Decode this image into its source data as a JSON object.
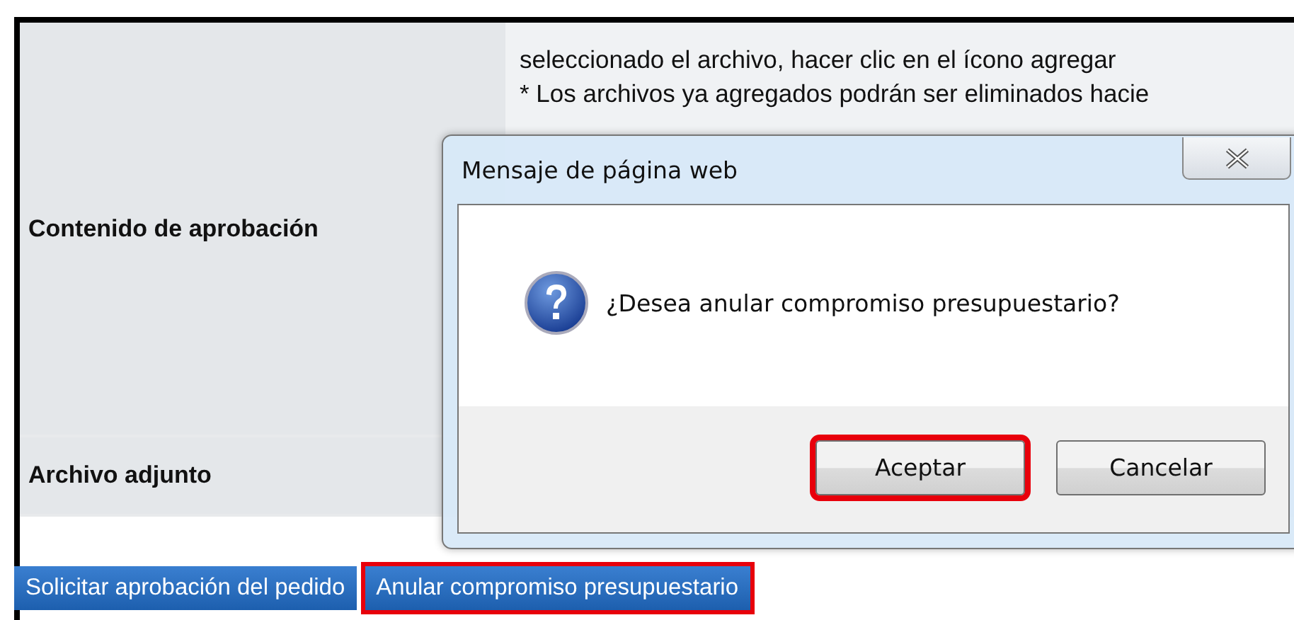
{
  "form": {
    "rows": [
      {
        "label": "Contenido de aprobación",
        "lines": [
          "seleccionado el archivo, hacer clic en el ícono agregar",
          "* Los archivos ya agregados podrán ser eliminados hacie"
        ]
      },
      {
        "label": "Archivo adjunto",
        "lines": []
      }
    ]
  },
  "actions": [
    {
      "label": "Solicitar aprobación del pedido",
      "highlighted": false
    },
    {
      "label": "Anular compromiso presupuestario",
      "highlighted": true
    }
  ],
  "dialog": {
    "title": "Mensaje de página web",
    "message": "¿Desea anular compromiso presupuestario?",
    "buttons": [
      {
        "label": "Aceptar",
        "highlighted": true
      },
      {
        "label": "Cancelar",
        "highlighted": false
      }
    ]
  }
}
